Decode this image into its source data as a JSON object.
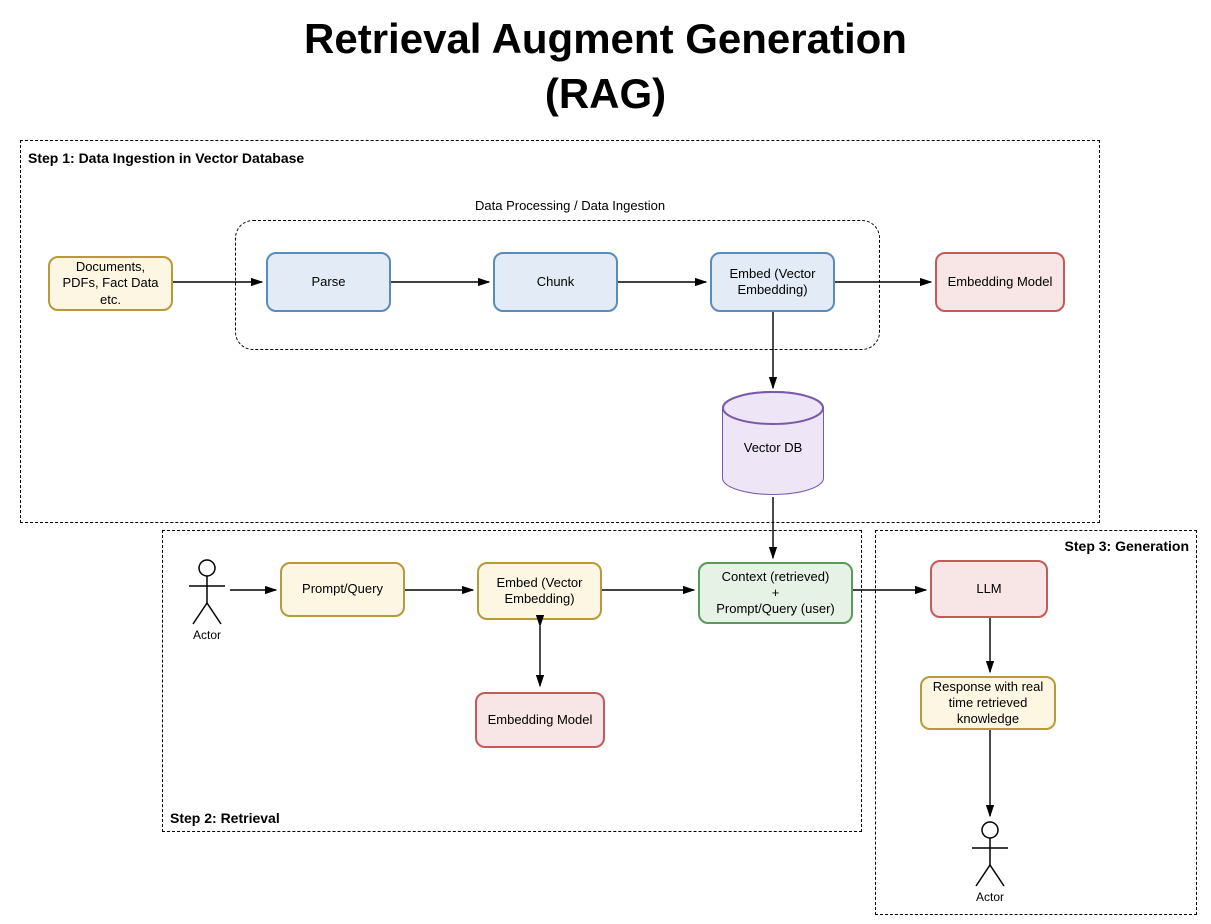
{
  "title_line1": "Retrieval Augment Generation",
  "title_line2": "(RAG)",
  "step1": {
    "label": "Step 1: Data Ingestion in Vector Database",
    "inner_label": "Data Processing / Data Ingestion",
    "documents": "Documents, PDFs, Fact Data etc.",
    "parse": "Parse",
    "chunk": "Chunk",
    "embed": "Embed (Vector Embedding)",
    "embedding_model": "Embedding Model",
    "vector_db": "Vector DB"
  },
  "step2": {
    "label": "Step 2: Retrieval",
    "actor": "Actor",
    "prompt_query": "Prompt/Query",
    "embed": "Embed (Vector Embedding)",
    "embedding_model": "Embedding Model",
    "context": "Context (retrieved)\n+\nPrompt/Query (user)"
  },
  "step3": {
    "label": "Step 3: Generation",
    "llm": "LLM",
    "response": "Response with real time retrieved knowledge",
    "actor": "Actor"
  }
}
